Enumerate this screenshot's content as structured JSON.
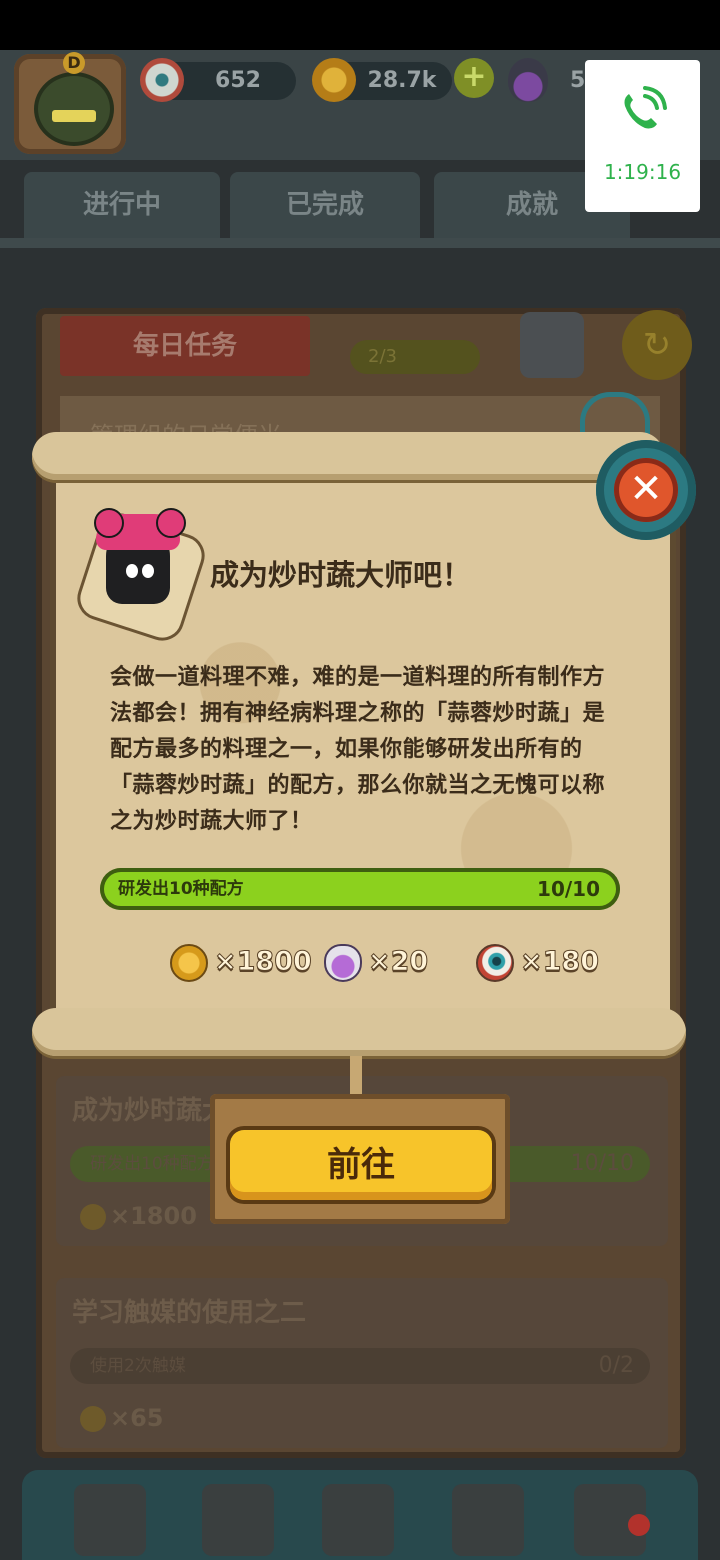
{
  "topbar": {
    "avatar_letter": "D",
    "eyes": "652",
    "coins": "28.7k",
    "plus": "+",
    "potions": "5"
  },
  "tabs": [
    {
      "label": "进行中"
    },
    {
      "label": "已完成"
    },
    {
      "label": "成就"
    }
  ],
  "daily": {
    "banner": "每日任务",
    "progress": "2/3",
    "refresh_icon": "↻",
    "peek_task_title": "管理组的日常便当"
  },
  "bg_tasks": [
    {
      "title": "成为炒时蔬大师吧！",
      "bar_label": "研发出10种配方",
      "bar_value": "10/10",
      "reward": "×1800",
      "progress": 1.0
    },
    {
      "title": "学习触媒的使用之二",
      "bar_label": "使用2次触媒",
      "bar_value": "0/2",
      "reward": "×65",
      "progress": 0.0
    }
  ],
  "modal": {
    "title": "成为炒时蔬大师吧！",
    "description": "会做一道料理不难，难的是一道料理的所有制作方法都会！拥有神经病料理之称的「蒜蓉炒时蔬」是配方最多的料理之一，如果你能够研发出所有的「蒜蓉炒时蔬」的配方，那么你就当之无愧可以称之为炒时蔬大师了！",
    "progress_label": "研发出10种配方",
    "progress_value": "10/10",
    "progress": 1.0,
    "rewards": {
      "coins": "×1800",
      "potions": "×20",
      "eyes": "×180"
    },
    "close_icon": "✕",
    "go_button": "前往"
  },
  "call": {
    "time": "1:19:16"
  },
  "colors": {
    "accent_green": "#8cd11e",
    "go_button_yellow": "#f7c42a",
    "close_red": "#e0562c",
    "call_green": "#2fb24c"
  }
}
